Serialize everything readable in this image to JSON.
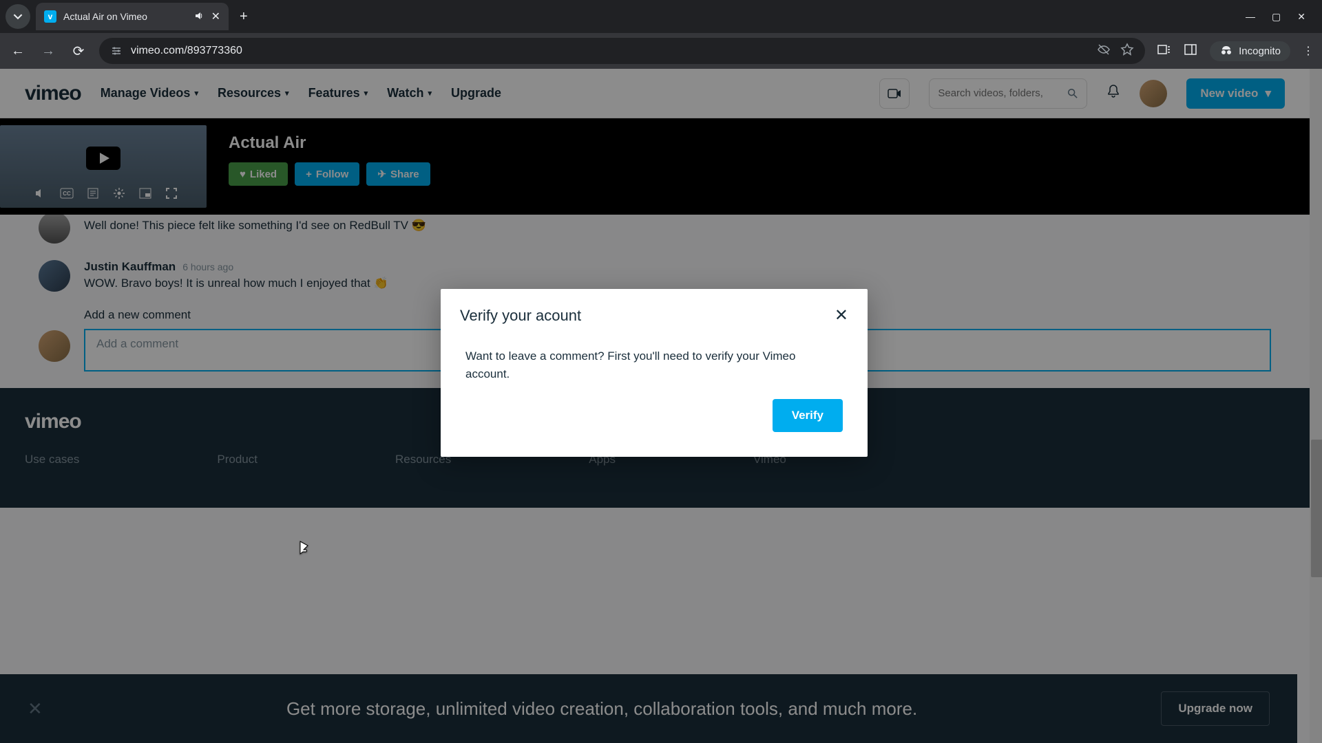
{
  "browser": {
    "tab_title": "Actual Air on Vimeo",
    "url": "vimeo.com/893773360",
    "incognito_label": "Incognito"
  },
  "nav": {
    "logo": "vimeo",
    "items": [
      "Manage Videos",
      "Resources",
      "Features",
      "Watch",
      "Upgrade"
    ],
    "search_placeholder": "Search videos, folders,",
    "new_video": "New video"
  },
  "video": {
    "title": "Actual Air",
    "liked": "Liked",
    "follow": "Follow",
    "share": "Share"
  },
  "comments": {
    "c1_text": "Well done! This piece felt like something I'd see on RedBull TV 😎",
    "c2_author": "Justin Kauffman",
    "c2_time": "6 hours ago",
    "c2_text": "WOW. Bravo boys! It is unreal how much I enjoyed that 👏",
    "add_label": "Add a new comment",
    "placeholder": "Add a comment"
  },
  "footer": {
    "logo": "vimeo",
    "cols": [
      "Use cases",
      "Product",
      "Resources",
      "Apps",
      "Vimeo"
    ]
  },
  "upsell": {
    "msg": "Get more storage, unlimited video creation, collaboration tools, and much more.",
    "cta": "Upgrade now"
  },
  "modal": {
    "title": "Verify your acount",
    "body": "Want to leave a comment? First you'll need to verify your Vimeo account.",
    "cta": "Verify"
  }
}
